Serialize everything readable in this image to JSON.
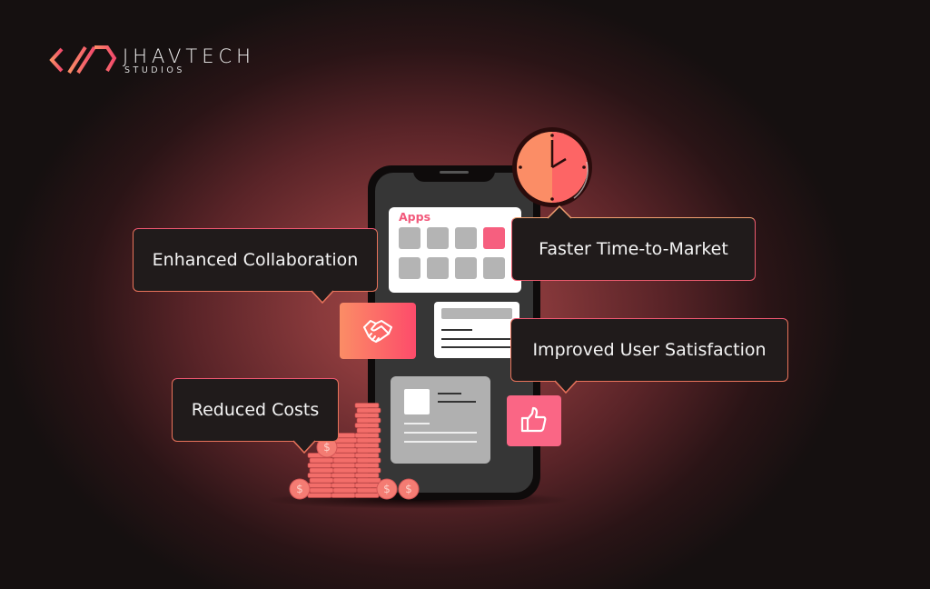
{
  "brand": {
    "name": "JHAVTECH",
    "subtitle": "STUDIOS",
    "logo_icon": "code-slash-icon",
    "colors": {
      "accent_orange": "#fb8d66",
      "accent_pink": "#f65f7f",
      "bubble_bg": "#201b1b"
    }
  },
  "phone": {
    "apps_card": {
      "title": "Apps",
      "tiles": [
        {
          "highlighted": false
        },
        {
          "highlighted": false
        },
        {
          "highlighted": false
        },
        {
          "highlighted": true
        },
        {
          "highlighted": false
        },
        {
          "highlighted": false
        },
        {
          "highlighted": false
        },
        {
          "highlighted": false
        }
      ]
    }
  },
  "clock": {
    "icon": "clock-icon",
    "time_shown": "2:00"
  },
  "callouts": [
    {
      "label": "Enhanced Collaboration",
      "icon": "handshake-icon"
    },
    {
      "label": "Faster Time-to-Market",
      "icon": "clock-icon"
    },
    {
      "label": "Improved User Satisfaction",
      "icon": "thumbs-up-icon"
    },
    {
      "label": "Reduced Costs",
      "icon": "coins-icon"
    }
  ]
}
